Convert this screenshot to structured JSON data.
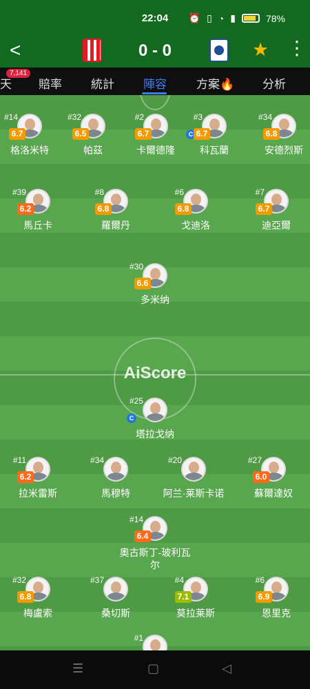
{
  "status": {
    "time": "22:04",
    "battery": "78%"
  },
  "header": {
    "back": "<",
    "score": "0 - 0",
    "star": "★",
    "more": "⋮"
  },
  "tabs": {
    "partial": "天",
    "odds": "賠率",
    "stats": "統計",
    "lineup": "陣容",
    "tips": "方案🔥",
    "analysis": "分析",
    "badge": "7,141"
  },
  "pitch": {
    "watermark": "AiScore"
  },
  "players": {
    "p1": {
      "num": "#14",
      "rating": "6.7",
      "name": "格洛米特"
    },
    "p2": {
      "num": "#32",
      "rating": "6.5",
      "name": "帕茲"
    },
    "p3": {
      "num": "#2",
      "rating": "6.7",
      "name": "卡爾德隆"
    },
    "p4": {
      "num": "#3",
      "rating": "6.7",
      "name": "科瓦蘭",
      "captain": "C"
    },
    "p5": {
      "num": "#34",
      "rating": "6.8",
      "name": "安德烈斯"
    },
    "p6": {
      "num": "#39",
      "rating": "6.2",
      "name": "馬丘卡"
    },
    "p7": {
      "num": "#8",
      "rating": "6.8",
      "name": "羅爾丹"
    },
    "p8": {
      "num": "#6",
      "rating": "6.8",
      "name": "戈迪洛"
    },
    "p9": {
      "num": "#7",
      "rating": "6.7",
      "name": "迪亞爾"
    },
    "p10": {
      "num": "#30",
      "rating": "6.6",
      "name": "多米纳"
    },
    "p11": {
      "num": "#25",
      "rating": "",
      "name": "塔拉戈纳",
      "captain": "C"
    },
    "p12": {
      "num": "#11",
      "rating": "6.2",
      "name": "拉米雷斯"
    },
    "p13": {
      "num": "#34",
      "rating": "",
      "name": "馬穆特"
    },
    "p14": {
      "num": "#20",
      "rating": "",
      "name": "阿兰·莱斯卡诺"
    },
    "p15": {
      "num": "#27",
      "rating": "6.0",
      "name": "蘇爾達奴"
    },
    "p16": {
      "num": "#14",
      "rating": "6.4",
      "name": "奧古斯丁-玻利瓦尔"
    },
    "p17": {
      "num": "#32",
      "rating": "6.8",
      "name": "梅盧索"
    },
    "p18": {
      "num": "#37",
      "rating": "",
      "name": "桑切斯"
    },
    "p19": {
      "num": "#4",
      "rating": "7.1",
      "name": "莫拉莱斯"
    },
    "p20": {
      "num": "#6",
      "rating": "6.9",
      "name": "恩里克"
    },
    "p21": {
      "num": "#1",
      "rating": "",
      "name": ""
    }
  },
  "nav": {
    "menu": "☰",
    "home": "▢",
    "back": "◁"
  },
  "colors": {
    "green": "#12691f",
    "orange": "#f29b00",
    "red": "#ff6a1a",
    "lime": "#9dbb00",
    "blue": "#3f7bff"
  }
}
